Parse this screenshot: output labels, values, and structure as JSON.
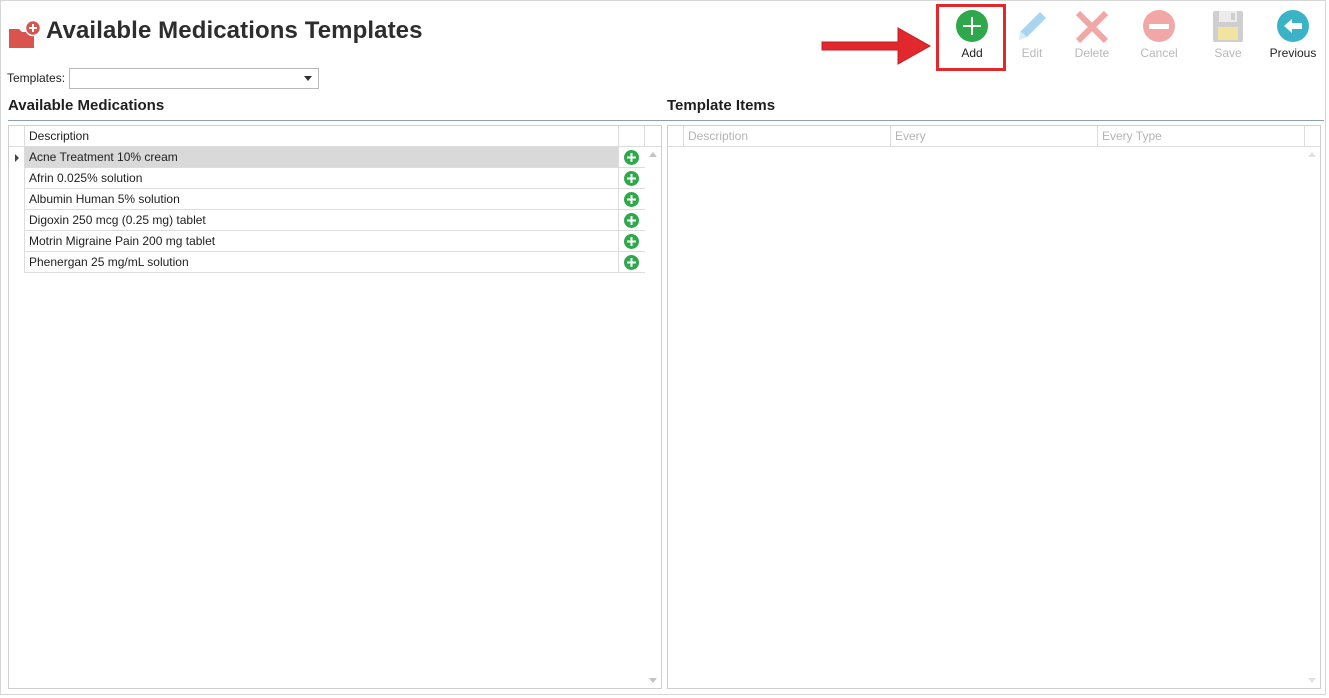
{
  "header": {
    "title": "Available Medications Templates",
    "icon": "folder-medical-icon"
  },
  "toolbar": {
    "buttons": [
      {
        "label": "Add",
        "icon": "add-icon",
        "enabled": true,
        "color": "#2ea84a"
      },
      {
        "label": "Edit",
        "icon": "pencil-icon",
        "enabled": false,
        "color": "#a9d4ee"
      },
      {
        "label": "Delete",
        "icon": "delete-x-icon",
        "enabled": false,
        "color": "#f2a7a7"
      },
      {
        "label": "Cancel",
        "icon": "cancel-icon",
        "enabled": false,
        "color": "#f2a7a7"
      },
      {
        "label": "Save",
        "icon": "save-disk-icon",
        "enabled": false,
        "color": "#cfcfcf"
      },
      {
        "label": "Previous",
        "icon": "back-arrow-icon",
        "enabled": true,
        "color": "#3bb3c6"
      }
    ]
  },
  "templates": {
    "label": "Templates:",
    "value": ""
  },
  "available_medications": {
    "title": "Available Medications",
    "columns": [
      "Description"
    ],
    "rows": [
      "Acne Treatment 10% cream",
      "Afrin 0.025% solution",
      "Albumin Human 5% solution",
      "Digoxin 250 mcg (0.25 mg) tablet",
      "Motrin Migraine Pain 200 mg tablet",
      "Phenergan 25 mg/mL solution"
    ],
    "selected_index": 0
  },
  "template_items": {
    "title": "Template Items",
    "columns": [
      "Description",
      "Every",
      "Every Type"
    ]
  },
  "colors": {
    "highlight": "#e0282d",
    "accent_green": "#2ea84a"
  }
}
